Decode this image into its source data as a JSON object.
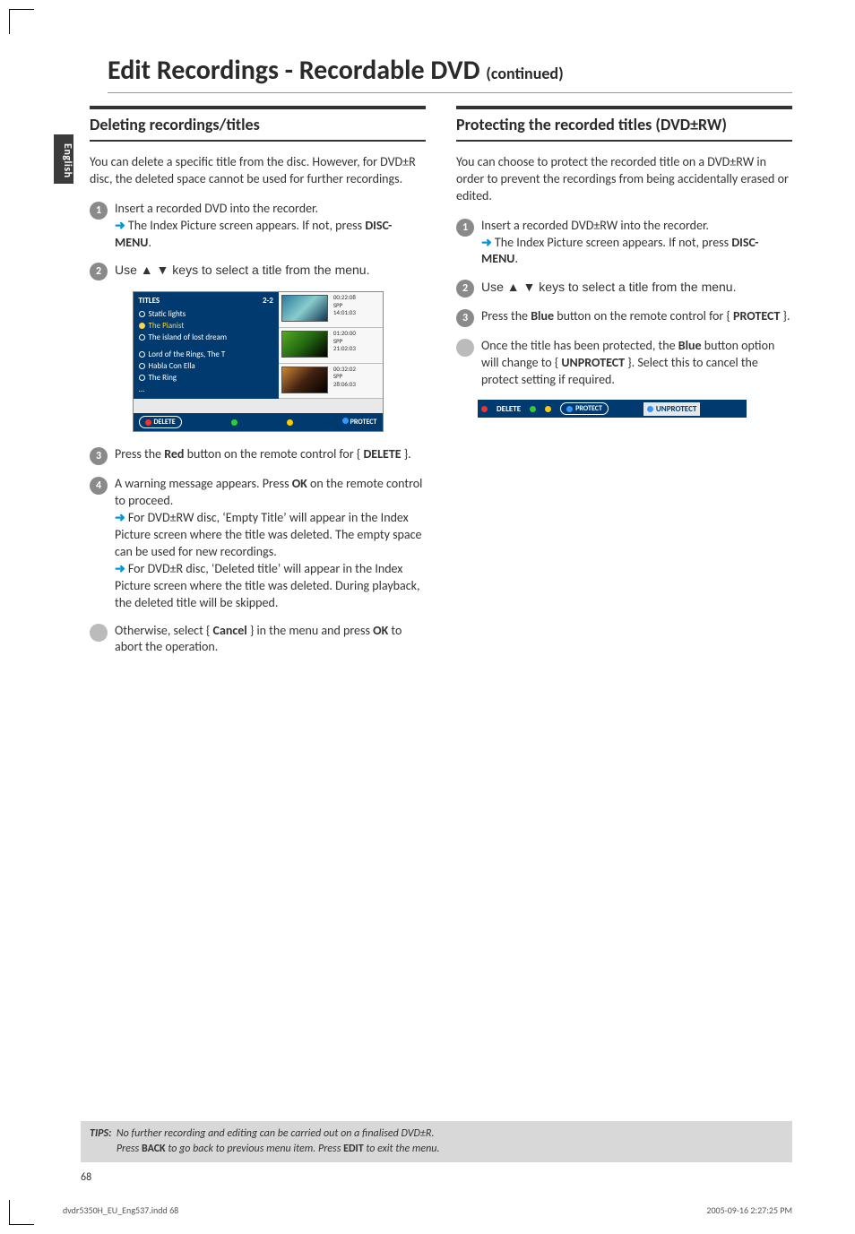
{
  "page": {
    "title_main": "Edit Recordings - Recordable DVD ",
    "title_cont": "(continued)",
    "sidebar_lang": "English",
    "page_number": "68",
    "footer_left": "dvdr5350H_EU_Eng537.indd   68",
    "footer_right": "2005-09-16   2:27:25 PM"
  },
  "left": {
    "section_title": "Deleting recordings/titles",
    "intro": "You can delete a specific title from the disc. However, for DVD±R disc, the deleted space cannot be used for further recordings.",
    "step1_a": "Insert a recorded DVD into the recorder.",
    "step1_b_pre": " The Index Picture screen appears. If not, press ",
    "step1_b_bold": "DISC-MENU",
    "step1_b_post": ".",
    "step2": "Use ▲ ▼ keys to select a title from the menu.",
    "step3_a": "Press the ",
    "step3_red": "Red",
    "step3_b": " button on the remote control for { ",
    "step3_delete": "DELETE",
    "step3_c": " }.",
    "step4_a": "A warning message appears. Press ",
    "step4_ok": "OK",
    "step4_b": " on the remote control to proceed.",
    "step4_rw": " For DVD±RW disc, ‘Empty Title’ will appear in the Index Picture screen where the title was deleted. The empty space can be used for new recordings.",
    "step4_r": " For DVD±R disc, ‘Deleted title’ will appear in the Index Picture screen where the title was deleted. During playback, the deleted title will be skipped.",
    "bullet_a": "Otherwise, select { ",
    "bullet_cancel": "Cancel",
    "bullet_b": " } in the menu and press ",
    "bullet_ok": "OK",
    "bullet_c": " to abort the operation."
  },
  "index_screen": {
    "header": "TITLES",
    "header_right": "2-2",
    "items": [
      "Static lights",
      "The Pianist",
      "The island of lost dream",
      "Lord of the Rings, The T",
      "Habla Con Ella",
      "The Ring",
      "..."
    ],
    "thumbs": [
      {
        "t": "00:22:08",
        "m": "SPP",
        "b": "14:01:03"
      },
      {
        "t": "01:20:00",
        "m": "SPP",
        "b": "21:02:03"
      },
      {
        "t": "00:32:02",
        "m": "SPP",
        "b": "28:06:03"
      }
    ],
    "delete": "DELETE",
    "protect": "PROTECT"
  },
  "right": {
    "section_title": "Protecting the recorded titles (DVD±RW)",
    "intro": "You can choose to protect the recorded title on a DVD±RW in order to prevent the recordings from being accidentally erased or edited.",
    "step1_a": "Insert a recorded DVD±RW into the recorder.",
    "step1_b_pre": " The Index Picture screen appears. If not, press ",
    "step1_b_bold": "DISC-MENU",
    "step1_b_post": ".",
    "step2": "Use ▲ ▼ keys to select a title from the menu.",
    "step3_a": "Press the ",
    "step3_blue": "Blue",
    "step3_b": " button on the remote control for { ",
    "step3_protect": "PROTECT",
    "step3_c": " }.",
    "bullet_a": "Once the title has been protected, the ",
    "bullet_blue": "Blue",
    "bullet_b": " button option will change to { ",
    "bullet_unprotect": "UNPROTECT",
    "bullet_c": " }. Select this to cancel the protect setting if required."
  },
  "protect_strip": {
    "delete": "DELETE",
    "protect": "PROTECT",
    "unprotect": "UNPROTECT"
  },
  "tips": {
    "label": "TIPS:",
    "line1_a": "No further recording and editing can be carried out on a finalised DVD±R.",
    "line2_a": "Press ",
    "line2_back": "BACK",
    "line2_b": " to go back to previous menu item. Press ",
    "line2_edit": "EDIT",
    "line2_c": " to exit the menu."
  }
}
